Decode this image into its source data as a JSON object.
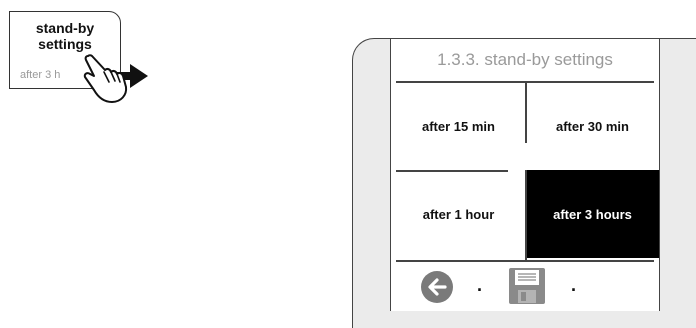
{
  "tile": {
    "title_line1": "stand-by",
    "title_line2": "settings",
    "subtitle": "after 3 h"
  },
  "screen": {
    "title": "1.3.3. stand-by settings",
    "options": [
      {
        "label": "after 15 min",
        "selected": false
      },
      {
        "label": "after 30 min",
        "selected": false
      },
      {
        "label": "after 1 hour",
        "selected": false
      },
      {
        "label": "after 3 hours",
        "selected": true
      }
    ],
    "separator_1": ".",
    "separator_2": "."
  },
  "icons": {
    "hand": "pointing-hand-icon",
    "arrow": "right-arrow-icon",
    "back": "back-arrow-icon",
    "save": "save-icon"
  },
  "colors": {
    "selected_bg": "#000000",
    "muted_text": "#9a9a9a",
    "icon_gray": "#7a7a7a",
    "panel_bg": "#ebebeb"
  }
}
